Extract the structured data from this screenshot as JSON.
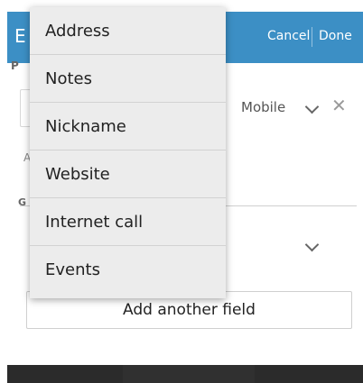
{
  "app_bar": {
    "title_peek": "E",
    "cancel_label": "Cancel",
    "done_label": "Done",
    "color": "#3c8fc5"
  },
  "form": {
    "phone_section_peek": "P",
    "phone_type": "Mobile",
    "address_section_peek": "A",
    "groups_section_peek": "G",
    "add_field_label": "Add another field"
  },
  "menu": {
    "items": [
      {
        "label": "Address"
      },
      {
        "label": "Notes"
      },
      {
        "label": "Nickname"
      },
      {
        "label": "Website"
      },
      {
        "label": "Internet call"
      },
      {
        "label": "Events"
      }
    ]
  },
  "icons": {
    "phone_type_dropdown": "chevron-down-icon",
    "remove_phone": "close-icon",
    "group_dropdown": "chevron-down-icon"
  }
}
